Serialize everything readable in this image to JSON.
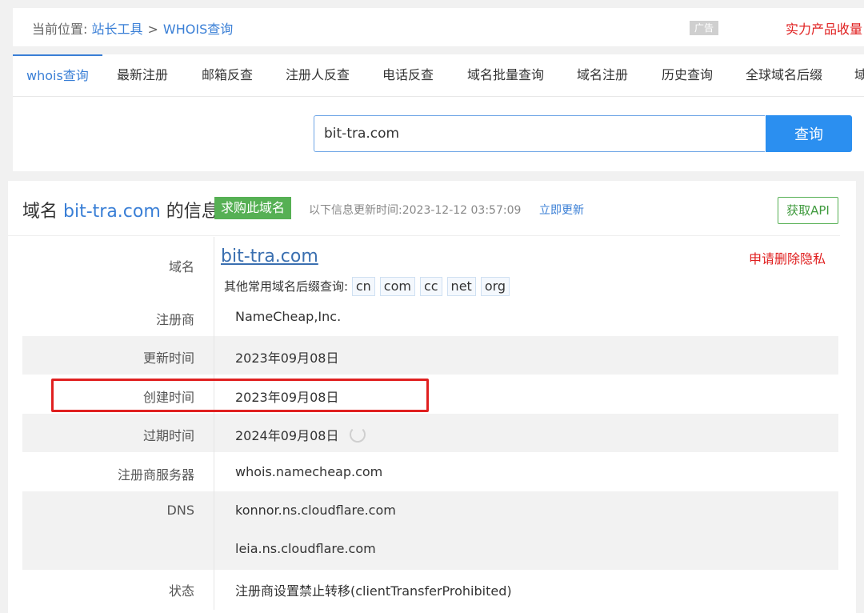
{
  "breadcrumb": {
    "prefix": "当前位置:",
    "home": "站长工具",
    "sep": ">",
    "current": "WHOIS查询"
  },
  "ad": {
    "tag": "广告",
    "link": "实力产品收量"
  },
  "tabs": [
    {
      "label": "whois查询",
      "active": true
    },
    {
      "label": "最新注册"
    },
    {
      "label": "邮箱反查"
    },
    {
      "label": "注册人反查"
    },
    {
      "label": "电话反查"
    },
    {
      "label": "域名批量查询"
    },
    {
      "label": "域名注册"
    },
    {
      "label": "历史查询"
    },
    {
      "label": "全球域名后缀"
    },
    {
      "label": "域"
    }
  ],
  "search": {
    "value": "bit-tra.com",
    "button": "查询"
  },
  "info": {
    "title_prefix": "域名",
    "domain": "bit-tra.com",
    "title_suffix": "的信息",
    "buy_button": "求购此域名",
    "update_text": "以下信息更新时间:2023-12-12 03:57:09",
    "update_link": "立即更新",
    "api_button": "获取API",
    "delete_privacy": "申请删除隐私",
    "suffix_label": "其他常用域名后缀查询:",
    "suffixes": [
      "cn",
      "com",
      "cc",
      "net",
      "org"
    ]
  },
  "rows": [
    {
      "label": "域名",
      "value": "bit-tra.com"
    },
    {
      "label": "注册商",
      "value": "NameCheap,Inc."
    },
    {
      "label": "更新时间",
      "value": "2023年09月08日"
    },
    {
      "label": "创建时间",
      "value": "2023年09月08日"
    },
    {
      "label": "过期时间",
      "value": "2024年09月08日"
    },
    {
      "label": "注册商服务器",
      "value": "whois.namecheap.com"
    },
    {
      "label": "DNS",
      "value": "konnor.ns.cloudflare.com"
    },
    {
      "label": "",
      "value": "leia.ns.cloudflare.com"
    },
    {
      "label": "状态",
      "value": "注册商设置禁止转移(clientTransferProhibited)"
    }
  ],
  "colors": {
    "accent": "#3a7fd6",
    "button": "#2b8ff0",
    "green": "#56b054",
    "alert": "#e02020"
  }
}
